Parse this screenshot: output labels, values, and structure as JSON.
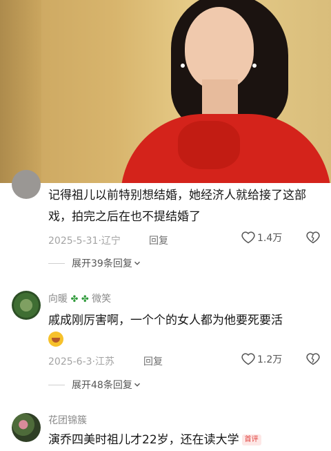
{
  "comments": [
    {
      "user": "",
      "text": "记得祖儿以前特别想结婚，她经济人就给接了这部戏，拍完之后在也不提结婚了",
      "date": "2025-5-31",
      "location": "辽宁",
      "reply_label": "回复",
      "likes": "1.4万",
      "expand_label": "展开39条回复"
    },
    {
      "user": "向暖",
      "user_suffix": "微笑",
      "text": "戚成刚厉害啊，一个个的女人都为他要死要活",
      "date": "2025-6-3",
      "location": "江苏",
      "reply_label": "回复",
      "likes": "1.2万",
      "expand_label": "展开48条回复"
    },
    {
      "user": "花团锦簇",
      "text": "演乔四美时祖儿才22岁，还在读大学",
      "badge": "首评"
    }
  ],
  "icons": {
    "heart": "heart-icon",
    "dislike": "broken-heart-icon",
    "chevron": "chevron-down-icon"
  }
}
